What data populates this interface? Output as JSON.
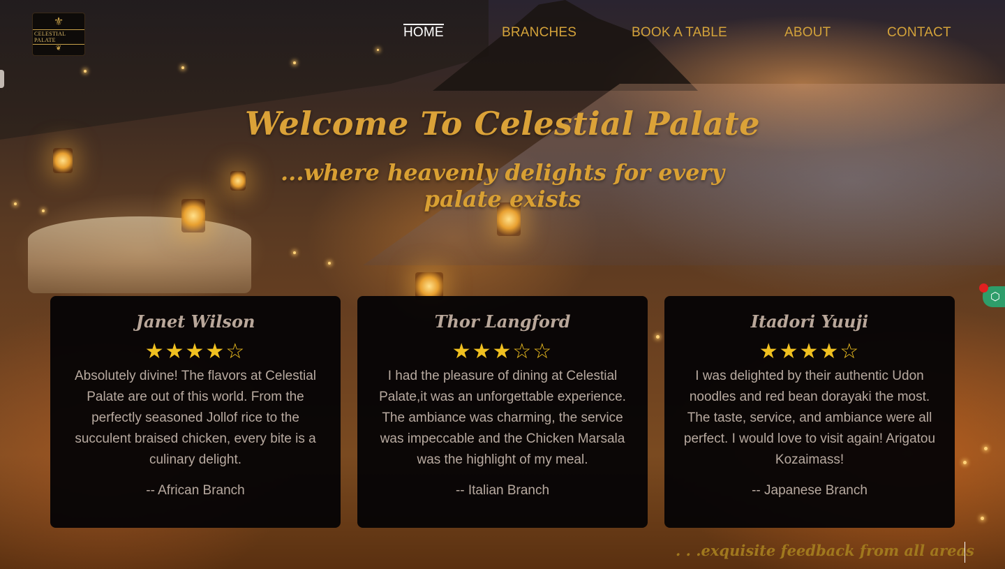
{
  "header": {
    "logo": {
      "text": "CELESTIAL PALATE",
      "crest_icon": "crest-icon"
    },
    "nav": [
      {
        "label": "HOME",
        "active": true
      },
      {
        "label": "BRANCHES",
        "active": false
      },
      {
        "label": "BOOK A TABLE",
        "active": false
      },
      {
        "label": "ABOUT",
        "active": false
      },
      {
        "label": "CONTACT",
        "active": false
      }
    ]
  },
  "hero": {
    "title": "Welcome To Celestial Palate",
    "subtitle": "...where heavenly delights for every palate exists"
  },
  "reviews": [
    {
      "name": "Janet Wilson",
      "stars": "★★★★☆",
      "rating": 4,
      "text": "Absolutely divine! The flavors at Celestial Palate are out of this world. From the perfectly seasoned Jollof rice to the succulent braised chicken, every bite is a culinary delight.",
      "branch": "-- African Branch"
    },
    {
      "name": "Thor Langford",
      "stars": "★★★☆☆",
      "rating": 3,
      "text": "I had the pleasure of dining at Celestial Palate,it was an unforgettable experience. The ambiance was charming, the service was impeccable and the Chicken Marsala was the highlight of my meal.",
      "branch": "-- Italian Branch"
    },
    {
      "name": "Itadori Yuuji",
      "stars": "★★★★☆",
      "rating": 4,
      "text": "I was delighted by their authentic Udon noodles and red bean dorayaki the most. The taste, service, and ambiance were all perfect. I would love to visit again! Arigatou Kozaimass!",
      "branch": "-- Japanese Branch"
    }
  ],
  "footer": {
    "tagline": ". . .exquisite feedback from all areas"
  },
  "colors": {
    "accent_gold": "#d4a33a",
    "card_bg": "#060405",
    "star": "#f0c020",
    "widget_green": "#2e9d6a"
  },
  "widget": {
    "icon": "hexagon-icon",
    "glyph": "⬡"
  }
}
